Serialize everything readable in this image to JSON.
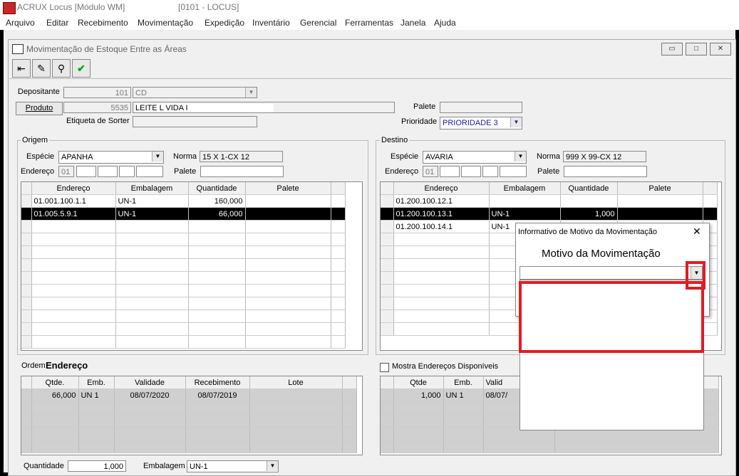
{
  "app": {
    "title": "ACRUX Locus [Módulo WM]",
    "subtitle": "[0101 - LOCUS]"
  },
  "menu": [
    "Arquivo",
    "Editar",
    "Recebimento",
    "Movimentação",
    "Expedição",
    "Inventário",
    "Gerencial",
    "Ferramentas",
    "Janela",
    "Ajuda"
  ],
  "window": {
    "title": "Movimentação de Estoque Entre as Áreas"
  },
  "header": {
    "depositante_label": "Depositante",
    "depositante_code": "101",
    "depositante_name": "CD",
    "produto_label": "Produto",
    "produto_code": "5535",
    "produto_name": "LEITE L VIDA I",
    "etiqueta_label": "Etiqueta de Sorter",
    "palete_label": "Palete",
    "prioridade_label": "Prioridade",
    "prioridade_value": "PRIORIDADE 3"
  },
  "origem": {
    "title": "Origem",
    "especie_label": "Espécie",
    "especie_value": "APANHA",
    "norma_label": "Norma",
    "norma_value": "15 X 1-CX 12",
    "endereco_label": "Endereço",
    "endereco_prefix": "01",
    "palete_label": "Palete",
    "columns": [
      "Endereço",
      "Embalagem",
      "Quantidade",
      "Palete"
    ],
    "rows": [
      {
        "endereco": "01.001.100.1.1",
        "embalagem": "UN-1",
        "quantidade": "160,000",
        "palete": ""
      },
      {
        "endereco": "01.005.5.9.1",
        "embalagem": "UN-1",
        "quantidade": "66,000",
        "palete": ""
      }
    ]
  },
  "destino": {
    "title": "Destino",
    "especie_label": "Espécie",
    "especie_value": "AVARIA",
    "norma_label": "Norma",
    "norma_value": "999 X 99-CX 12",
    "endereco_label": "Endereço",
    "endereco_prefix": "01",
    "palete_label": "Palete",
    "columns": [
      "Endereço",
      "Embalagem",
      "Quantidade",
      "Palete"
    ],
    "rows": [
      {
        "endereco": "01.200.100.12.1",
        "embalagem": "",
        "quantidade": "",
        "palete": ""
      },
      {
        "endereco": "01.200.100.13.1",
        "embalagem": "UN-1",
        "quantidade": "1,000",
        "palete": ""
      },
      {
        "endereco": "01.200.100.14.1",
        "embalagem": "UN-1",
        "quantidade": "",
        "palete": ""
      }
    ]
  },
  "ordem": {
    "label": "Ordem",
    "bold": "Endereço",
    "columns": [
      "Qtde.",
      "Emb.",
      "Validade",
      "Recebimento",
      "Lote"
    ],
    "rows": [
      {
        "qtde": "66,000",
        "emb": "UN 1",
        "validade": "08/07/2020",
        "recebimento": "08/07/2019",
        "lote": ""
      }
    ]
  },
  "mostra": {
    "label": "Mostra Endereços Disponíveis",
    "columns": [
      "Qtde",
      "Emb.",
      "Valid"
    ],
    "rows": [
      {
        "qtde": "1,000",
        "emb": "UN 1",
        "valid": "08/07/"
      }
    ]
  },
  "footer": {
    "quantidade_label": "Quantidade",
    "quantidade_value": "1,000",
    "embalagem_label": "Embalagem",
    "embalagem_value": "UN-1"
  },
  "dialog": {
    "title": "Informativo de Motivo da Movimentação",
    "heading": "Motivo da Movimentação",
    "close": "✕"
  },
  "colors": {
    "highlight": "#e21b23",
    "selected_row": "#000000"
  }
}
